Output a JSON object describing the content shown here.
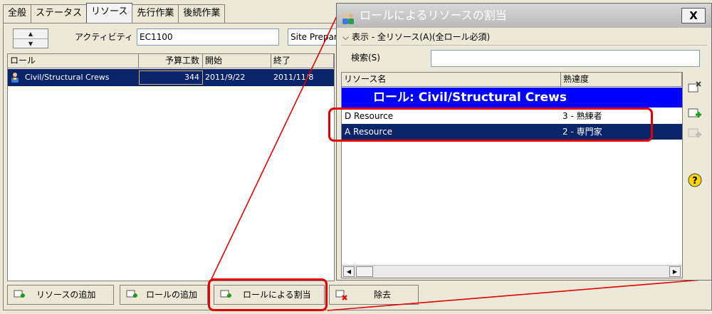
{
  "tabs": [
    "全般",
    "ステータス",
    "リソース",
    "先行作業",
    "後続作業"
  ],
  "activity": {
    "label": "アクティビティ",
    "id": "EC1100",
    "name": "Site Prepar"
  },
  "table": {
    "columns": [
      "ロール",
      "予算工数",
      "開始",
      "終了"
    ],
    "rows": [
      {
        "role": "Civil/Structural Crews",
        "budget": "344",
        "start": "2011/9/22",
        "end": "2011/11/8"
      }
    ]
  },
  "buttons": {
    "add_resource": "リソースの追加",
    "add_role": "ロールの追加",
    "assign_by_role": "ロールによる割当",
    "remove": "除去"
  },
  "dialog": {
    "title": "ロールによるリソースの割当",
    "close": "X",
    "filter_label": "表示 - 全リソース(A)(全ロール必須)",
    "search_label": "検索(S)",
    "search_value": "",
    "columns": [
      "リソース名",
      "熟達度"
    ],
    "role_header": "ロール: Civil/Structural Crews",
    "resources": [
      {
        "name": "D Resource",
        "proficiency": "3 - 熟練者"
      },
      {
        "name": "A Resource",
        "proficiency": "2 - 専門家"
      }
    ]
  },
  "colors": {
    "selection": "#0a246a",
    "role_header": "#0000ff",
    "highlight": "#e00000"
  }
}
